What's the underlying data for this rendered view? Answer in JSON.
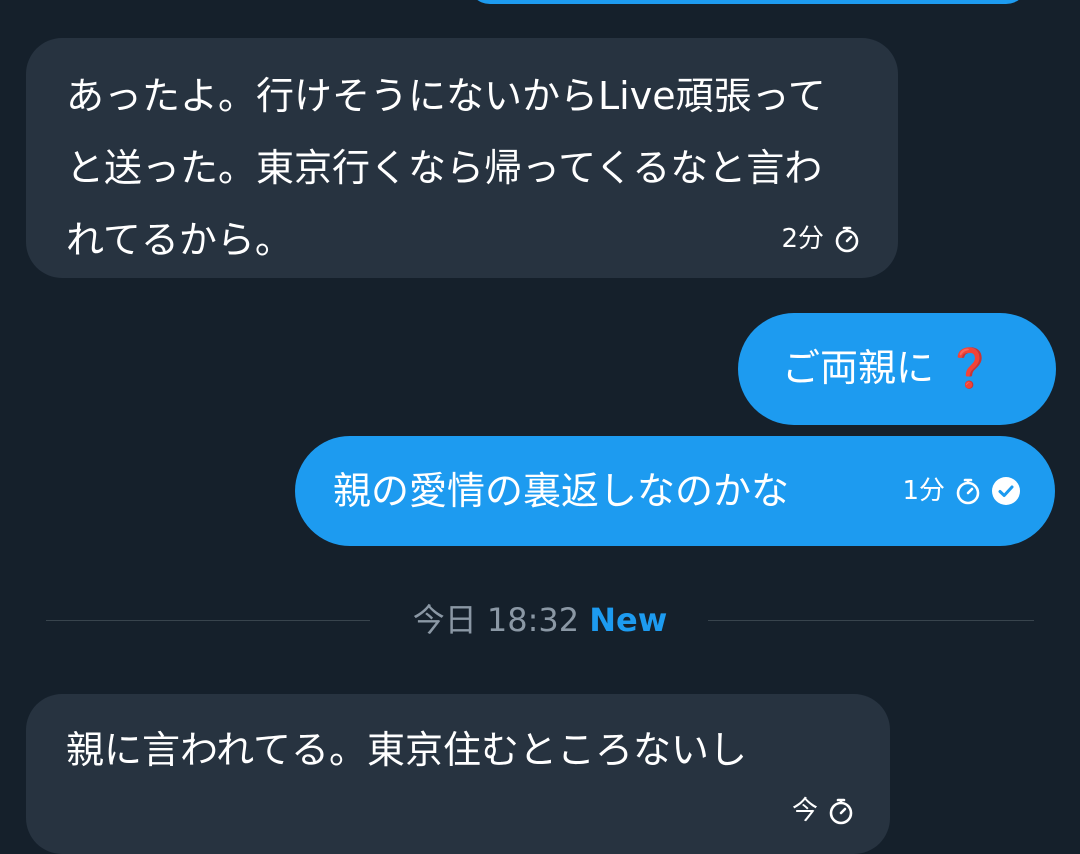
{
  "messages": [
    {
      "direction": "received",
      "text": "あったよ。行けそうにないからLive頑張ってと送った。東京行くなら帰ってくるなと言われてるから。",
      "time": "2分",
      "timer_icon": "stopwatch-icon"
    },
    {
      "direction": "sent",
      "text": "ご両親に",
      "emoji": "❓"
    },
    {
      "direction": "sent",
      "text": "親の愛情の裏返しなのかな",
      "time": "1分",
      "timer_icon": "stopwatch-icon",
      "status_icon": "check-circle-icon"
    },
    {
      "direction": "received",
      "text": "親に言われてる。東京住むところないし",
      "time": "今",
      "timer_icon": "stopwatch-icon"
    }
  ],
  "divider": {
    "date": "今日 18:32",
    "new_label": "New"
  },
  "colors": {
    "background": "#15202b",
    "received_bubble": "#273340",
    "sent_bubble": "#1d9bf0",
    "accent": "#1d9bf0",
    "muted_text": "#8b98a5"
  }
}
